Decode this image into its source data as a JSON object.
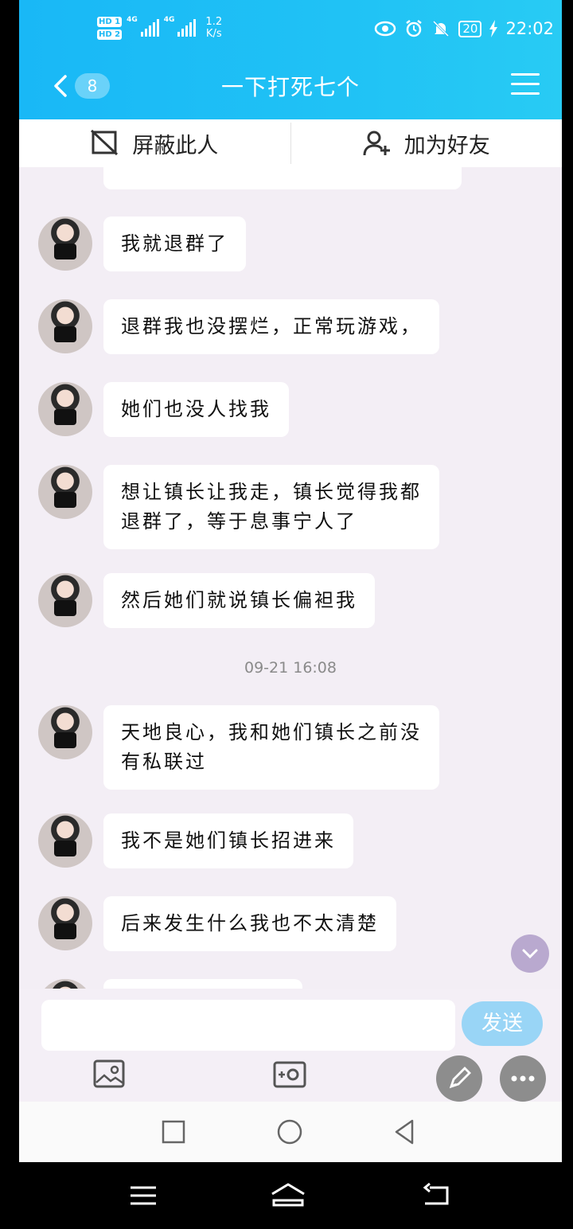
{
  "status_bar": {
    "sim1": "HD 1",
    "sim2": "HD 2",
    "net1": "4G",
    "net2": "4G",
    "speed_value": "1.2",
    "speed_unit": "K/s",
    "battery": "20",
    "time": "22:02",
    "icons": [
      "eye-icon",
      "alarm-icon",
      "mute-bell-icon",
      "charging-icon"
    ]
  },
  "header": {
    "unread_count": "8",
    "title": "一下打死七个"
  },
  "action_bar": {
    "block_label": "屏蔽此人",
    "add_friend_label": "加为好友"
  },
  "messages": [
    {
      "text": "我就退群了"
    },
    {
      "text": "退群我也没摆烂，正常玩游戏，"
    },
    {
      "text": "她们也没人找我"
    },
    {
      "text_line1": "想让镇长让我走，镇长觉得我都",
      "text_line2": "退群了，等于息事宁人了"
    },
    {
      "text": "然后她们就说镇长偏袒我"
    },
    {
      "text_line1": "天地良心，我和她们镇长之前没",
      "text_line2": "有私联过"
    },
    {
      "text": "我不是她们镇长招进来"
    },
    {
      "text": "后来发生什么我也不太清楚"
    }
  ],
  "timestamp": "09-21 16:08",
  "input_bar": {
    "placeholder": "",
    "send_label": "发送"
  },
  "colors": {
    "header_blue": "#1db9f4",
    "send_button": "#99d5f6",
    "chat_background": "#f3eef5"
  }
}
